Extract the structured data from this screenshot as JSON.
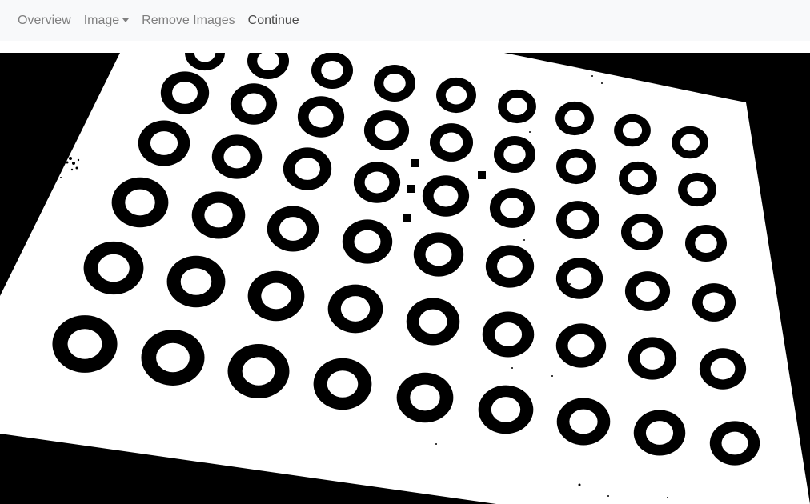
{
  "navbar": {
    "items": [
      {
        "label": "Overview",
        "active": false,
        "dropdown": false
      },
      {
        "label": "Image",
        "active": false,
        "dropdown": true
      },
      {
        "label": "Remove Images",
        "active": false,
        "dropdown": false
      },
      {
        "label": "Continue",
        "active": true,
        "dropdown": false
      }
    ]
  },
  "image": {
    "description_colors": {
      "board": "#ffffff",
      "background": "#000000",
      "navbar_bg": "#f8f9fa"
    },
    "pattern": "ring-grid"
  }
}
